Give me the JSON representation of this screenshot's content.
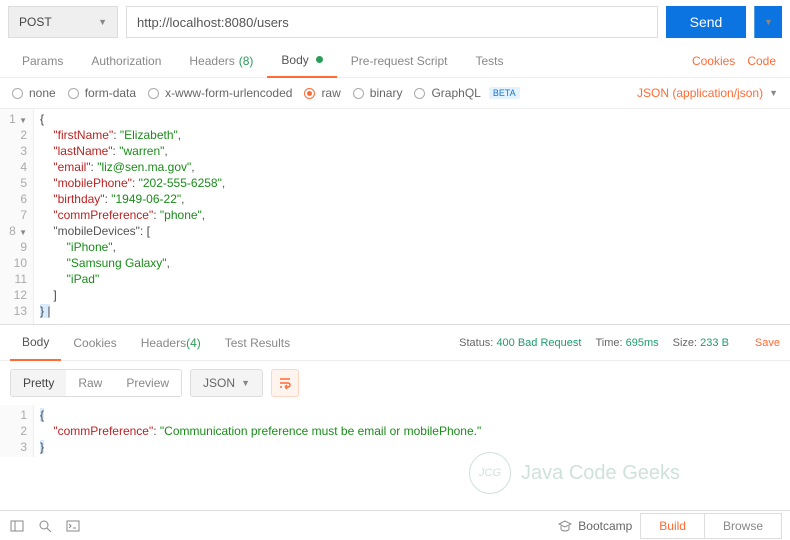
{
  "request": {
    "method": "POST",
    "url": "http://localhost:8080/users",
    "send_label": "Send"
  },
  "tabs": {
    "params": "Params",
    "authorization": "Authorization",
    "headers": "Headers",
    "headers_count": "(8)",
    "body": "Body",
    "prerequest": "Pre-request Script",
    "tests": "Tests",
    "cookies_link": "Cookies",
    "code_link": "Code"
  },
  "body_types": {
    "none": "none",
    "formdata": "form-data",
    "urlencoded": "x-www-form-urlencoded",
    "raw": "raw",
    "binary": "binary",
    "graphql": "GraphQL",
    "beta": "BETA",
    "content_type": "JSON (application/json)"
  },
  "request_body_lines": [
    "{",
    "    \"firstName\": \"Elizabeth\",",
    "    \"lastName\": \"warren\",",
    "    \"email\": \"liz@sen.ma.gov\",",
    "    \"mobilePhone\": \"202-555-6258\",",
    "    \"birthday\": \"1949-06-22\",",
    "    \"commPreference\": \"phone\",",
    "    \"mobileDevices\": [",
    "        \"iPhone\",",
    "        \"Samsung Galaxy\",",
    "        \"iPad\"",
    "    ]",
    "} "
  ],
  "response": {
    "tabs": {
      "body": "Body",
      "cookies": "Cookies",
      "headers": "Headers",
      "headers_count": "(4)",
      "tests": "Test Results"
    },
    "status_label": "Status:",
    "status_value": "400 Bad Request",
    "time_label": "Time:",
    "time_value": "695ms",
    "size_label": "Size:",
    "size_value": "233 B",
    "save": "Save",
    "views": {
      "pretty": "Pretty",
      "raw": "Raw",
      "preview": "Preview"
    },
    "format": "JSON",
    "body_lines": [
      "{",
      "    \"commPreference\": \"Communication preference must be email or mobilePhone.\"",
      "}"
    ]
  },
  "footer": {
    "bootcamp": "Bootcamp",
    "build": "Build",
    "browse": "Browse"
  },
  "watermark": {
    "initials": "JCG",
    "text": "Java Code Geeks"
  }
}
